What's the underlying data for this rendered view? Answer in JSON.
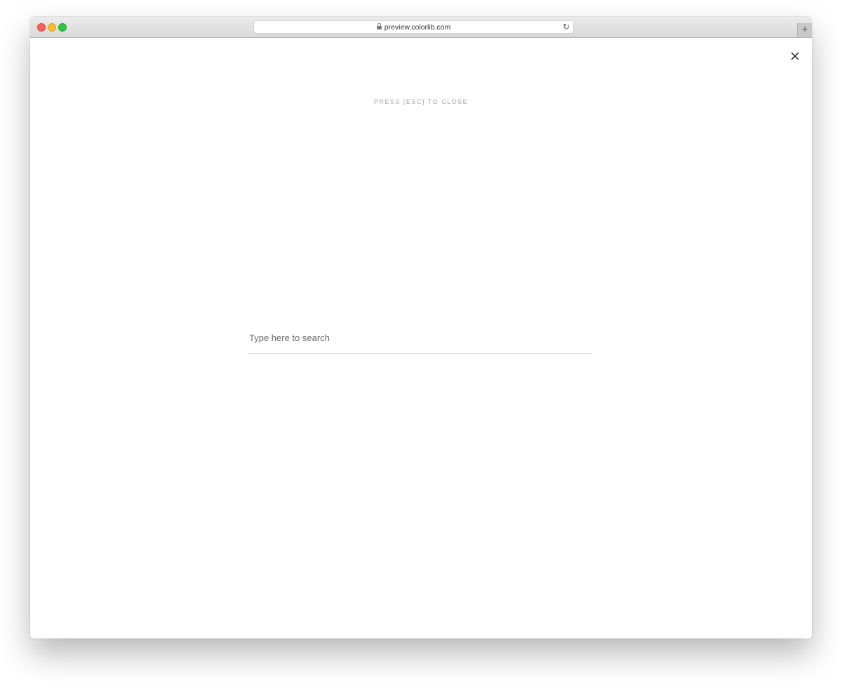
{
  "browser": {
    "url": "preview.colorlib.com",
    "reload_glyph": "↻",
    "newtab_glyph": "+",
    "icons": {
      "lock": "lock-icon",
      "reload": "reload-icon",
      "close": "close-icon"
    }
  },
  "overlay": {
    "hint": "PRESS [ESC] TO CLOSE",
    "search": {
      "placeholder": "Type here to search",
      "value": ""
    }
  },
  "colors": {
    "background": "#ffffff",
    "hint_text": "#aaaaaa",
    "underline": "#d4d4d4",
    "traffic_close": "#fc5f57",
    "traffic_minimize": "#fdbc2e",
    "traffic_zoom": "#29c941"
  }
}
